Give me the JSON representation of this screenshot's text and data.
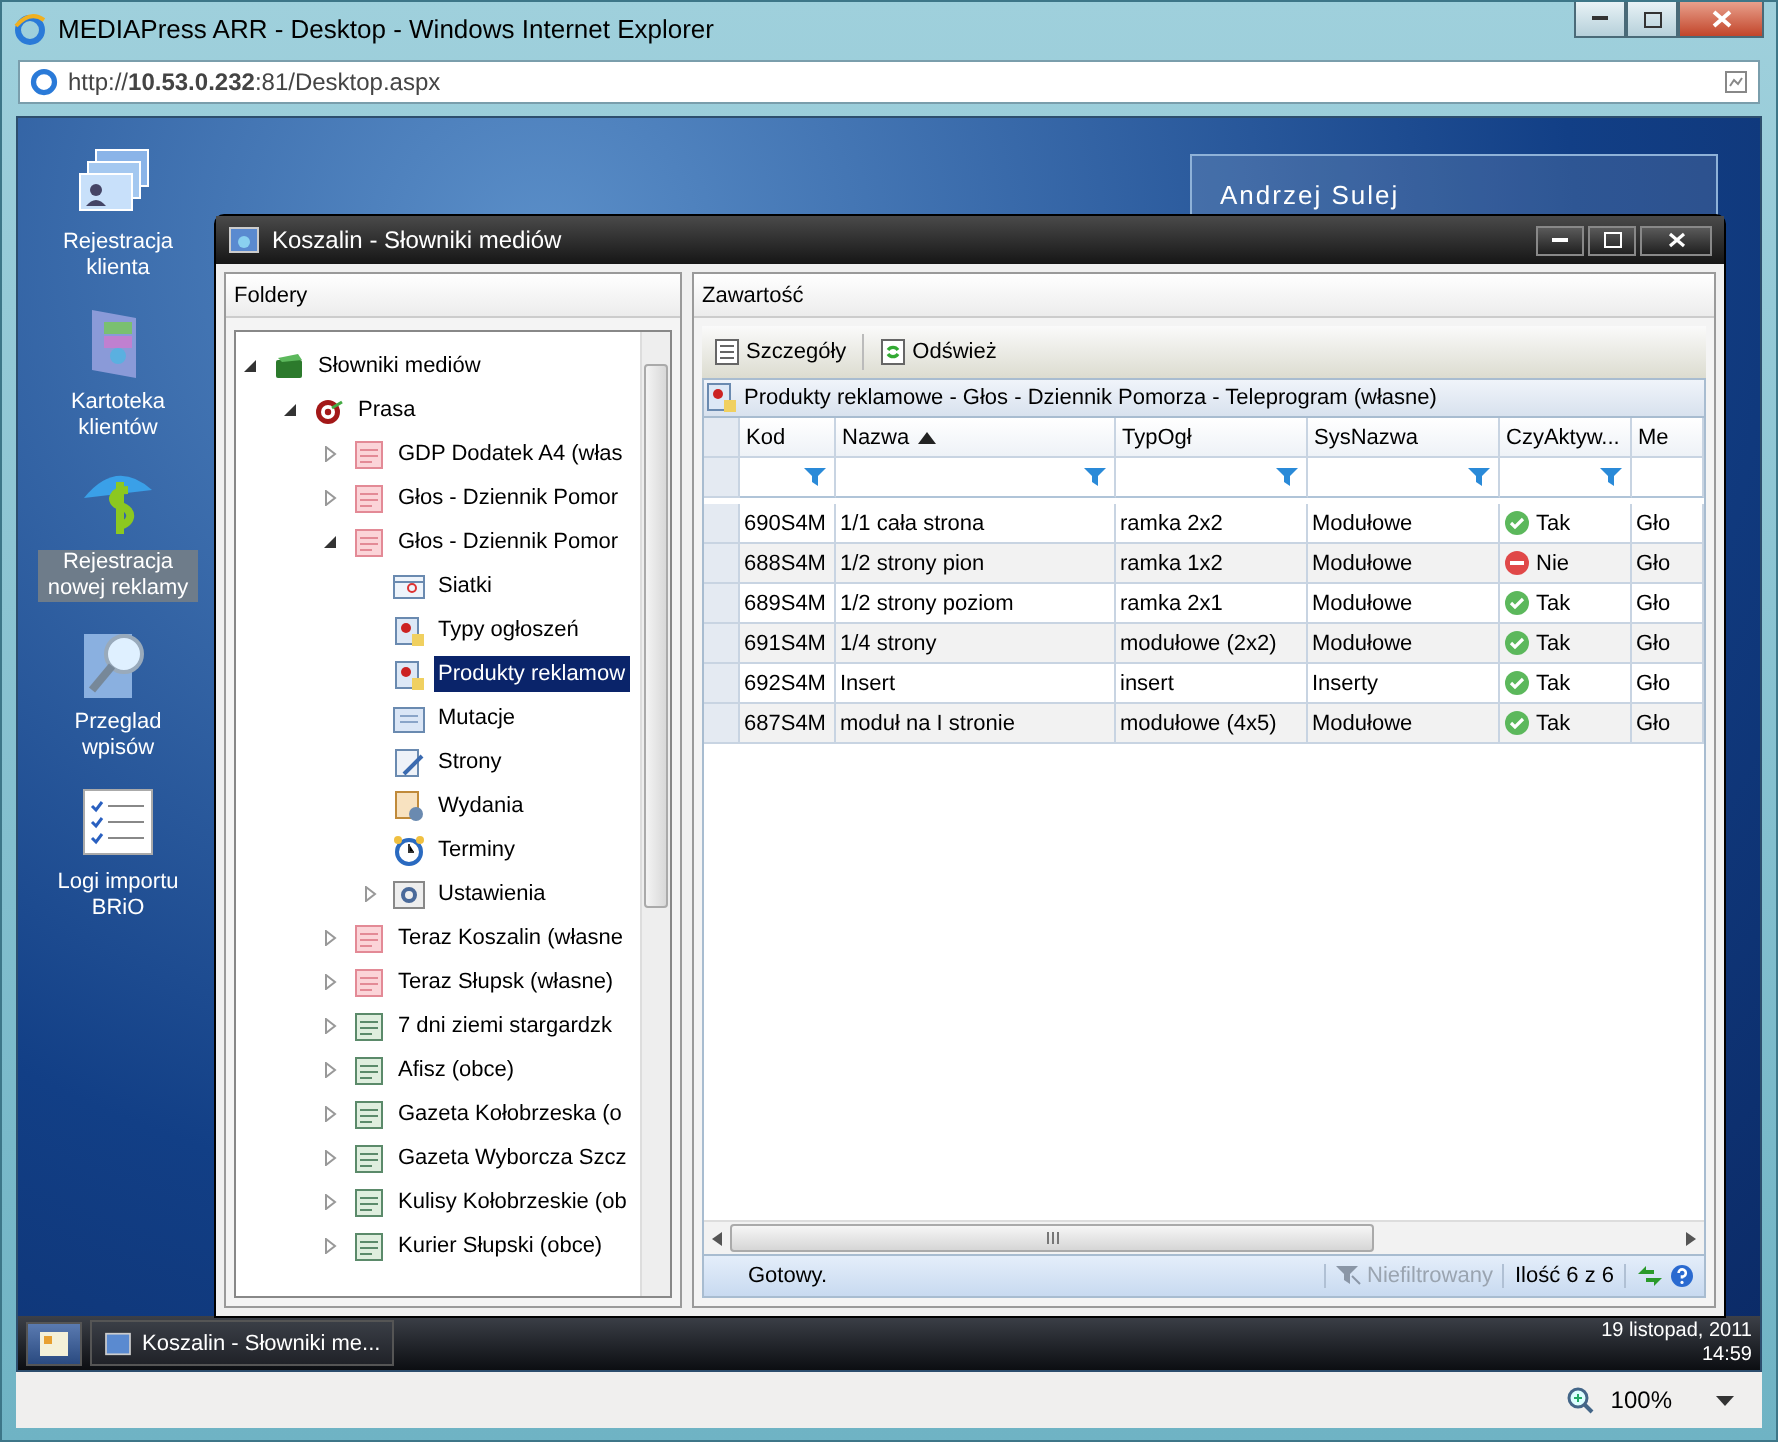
{
  "browser": {
    "title": "MEDIAPress ARR - Desktop - Windows Internet Explorer",
    "address": "http://**10.53.0.232**:81/Desktop.aspx",
    "zoom": "100%"
  },
  "desktop": {
    "user": "Andrzej Sulej",
    "icons": [
      {
        "label": "Rejestracja klienta",
        "kind": "cards",
        "selected": false
      },
      {
        "label": "Kartoteka klientów",
        "kind": "folder",
        "selected": false
      },
      {
        "label": "Rejestracja nowej reklamy",
        "kind": "money",
        "selected": true
      },
      {
        "label": "Przeglad wpisów",
        "kind": "search",
        "selected": false
      },
      {
        "label": "Logi importu BRiO",
        "kind": "list",
        "selected": false
      }
    ]
  },
  "dialog": {
    "title": "Koszalin - Słowniki mediów",
    "folders": {
      "header": "Foldery",
      "tree": [
        {
          "label": "Słowniki mediów",
          "kind": "book",
          "expanded": true,
          "selected": false,
          "children": [
            {
              "label": "Prasa",
              "kind": "target",
              "expanded": true,
              "selected": false,
              "children": [
                {
                  "label": "GDP Dodatek A4 (włas",
                  "kind": "pink",
                  "expanded": false,
                  "selected": false
                },
                {
                  "label": "Głos - Dziennik Pomor",
                  "kind": "pink",
                  "expanded": false,
                  "selected": false
                },
                {
                  "label": "Głos - Dziennik Pomor",
                  "kind": "pink",
                  "expanded": true,
                  "selected": false,
                  "children": [
                    {
                      "label": "Siatki",
                      "kind": "grid",
                      "selected": false
                    },
                    {
                      "label": "Typy ogłoszeń",
                      "kind": "badge",
                      "selected": false
                    },
                    {
                      "label": "Produkty reklamow",
                      "kind": "badge",
                      "selected": true
                    },
                    {
                      "label": "Mutacje",
                      "kind": "page",
                      "selected": false
                    },
                    {
                      "label": "Strony",
                      "kind": "pen",
                      "selected": false
                    },
                    {
                      "label": "Wydania",
                      "kind": "doc",
                      "selected": false
                    },
                    {
                      "label": "Terminy",
                      "kind": "clock",
                      "selected": false
                    },
                    {
                      "label": "Ustawienia",
                      "kind": "gear",
                      "expanded": false,
                      "selected": false
                    }
                  ]
                },
                {
                  "label": "Teraz Koszalin (własne",
                  "kind": "pink",
                  "expanded": false,
                  "selected": false
                },
                {
                  "label": "Teraz Słupsk (własne)",
                  "kind": "pink",
                  "expanded": false,
                  "selected": false
                },
                {
                  "label": "7 dni ziemi stargardzk",
                  "kind": "green",
                  "expanded": false,
                  "selected": false
                },
                {
                  "label": "Afisz (obce)",
                  "kind": "green",
                  "expanded": false,
                  "selected": false
                },
                {
                  "label": "Gazeta Kołobrzeska (o",
                  "kind": "green",
                  "expanded": false,
                  "selected": false
                },
                {
                  "label": "Gazeta Wyborcza Szcz",
                  "kind": "green",
                  "expanded": false,
                  "selected": false
                },
                {
                  "label": "Kulisy Kołobrzeskie (ob",
                  "kind": "green",
                  "expanded": false,
                  "selected": false
                },
                {
                  "label": "Kurier Słupski (obce)",
                  "kind": "green",
                  "expanded": false,
                  "selected": false
                }
              ]
            }
          ]
        }
      ]
    },
    "content": {
      "header": "Zawartość",
      "toolbar": [
        {
          "label": "Szczegóły",
          "kind": "details"
        },
        {
          "label": "Odśwież",
          "kind": "refresh"
        }
      ],
      "grid_title": "Produkty reklamowe - Głos - Dziennik Pomorza - Teleprogram (własne)",
      "columns": [
        {
          "label": "Kod",
          "sorted": false,
          "filter": true
        },
        {
          "label": "Nazwa",
          "sorted": true,
          "filter": true
        },
        {
          "label": "TypOgł",
          "sorted": false,
          "filter": true
        },
        {
          "label": "SysNazwa",
          "sorted": false,
          "filter": true
        },
        {
          "label": "CzyAktyw...",
          "sorted": false,
          "filter": true
        },
        {
          "label": "Me",
          "sorted": false,
          "filter": false
        }
      ],
      "rows": [
        {
          "cells": [
            "690S4M",
            "1/1 cała strona",
            "ramka 2x2",
            "Modułowe"
          ],
          "active": true,
          "status": "Tak",
          "column_6": "Gło"
        },
        {
          "cells": [
            "688S4M",
            "1/2 strony pion",
            "ramka 1x2",
            "Modułowe"
          ],
          "active": false,
          "status": "Nie",
          "column_6": "Gło"
        },
        {
          "cells": [
            "689S4M",
            "1/2 strony poziom",
            "ramka 2x1",
            "Modułowe"
          ],
          "active": true,
          "status": "Tak",
          "column_6": "Gło"
        },
        {
          "cells": [
            "691S4M",
            "1/4 strony",
            "modułowe (2x2)",
            "Modułowe"
          ],
          "active": true,
          "status": "Tak",
          "column_6": "Gło"
        },
        {
          "cells": [
            "692S4M",
            "Insert",
            "insert",
            "Inserty"
          ],
          "active": true,
          "status": "Tak",
          "column_6": "Gło"
        },
        {
          "cells": [
            "687S4M",
            "moduł na I stronie",
            "modułowe (4x5)",
            "Modułowe"
          ],
          "active": true,
          "status": "Tak",
          "column_6": "Gło"
        }
      ],
      "status_bar": {
        "message": "Gotowy.",
        "filter": "Niefiltrowany",
        "filter_disabled": true,
        "count": "Ilość 6 z 6"
      }
    }
  },
  "taskbar": {
    "task": "Koszalin - Słowniki me...",
    "date": "19 listopad, 2011",
    "time": "14:59"
  }
}
